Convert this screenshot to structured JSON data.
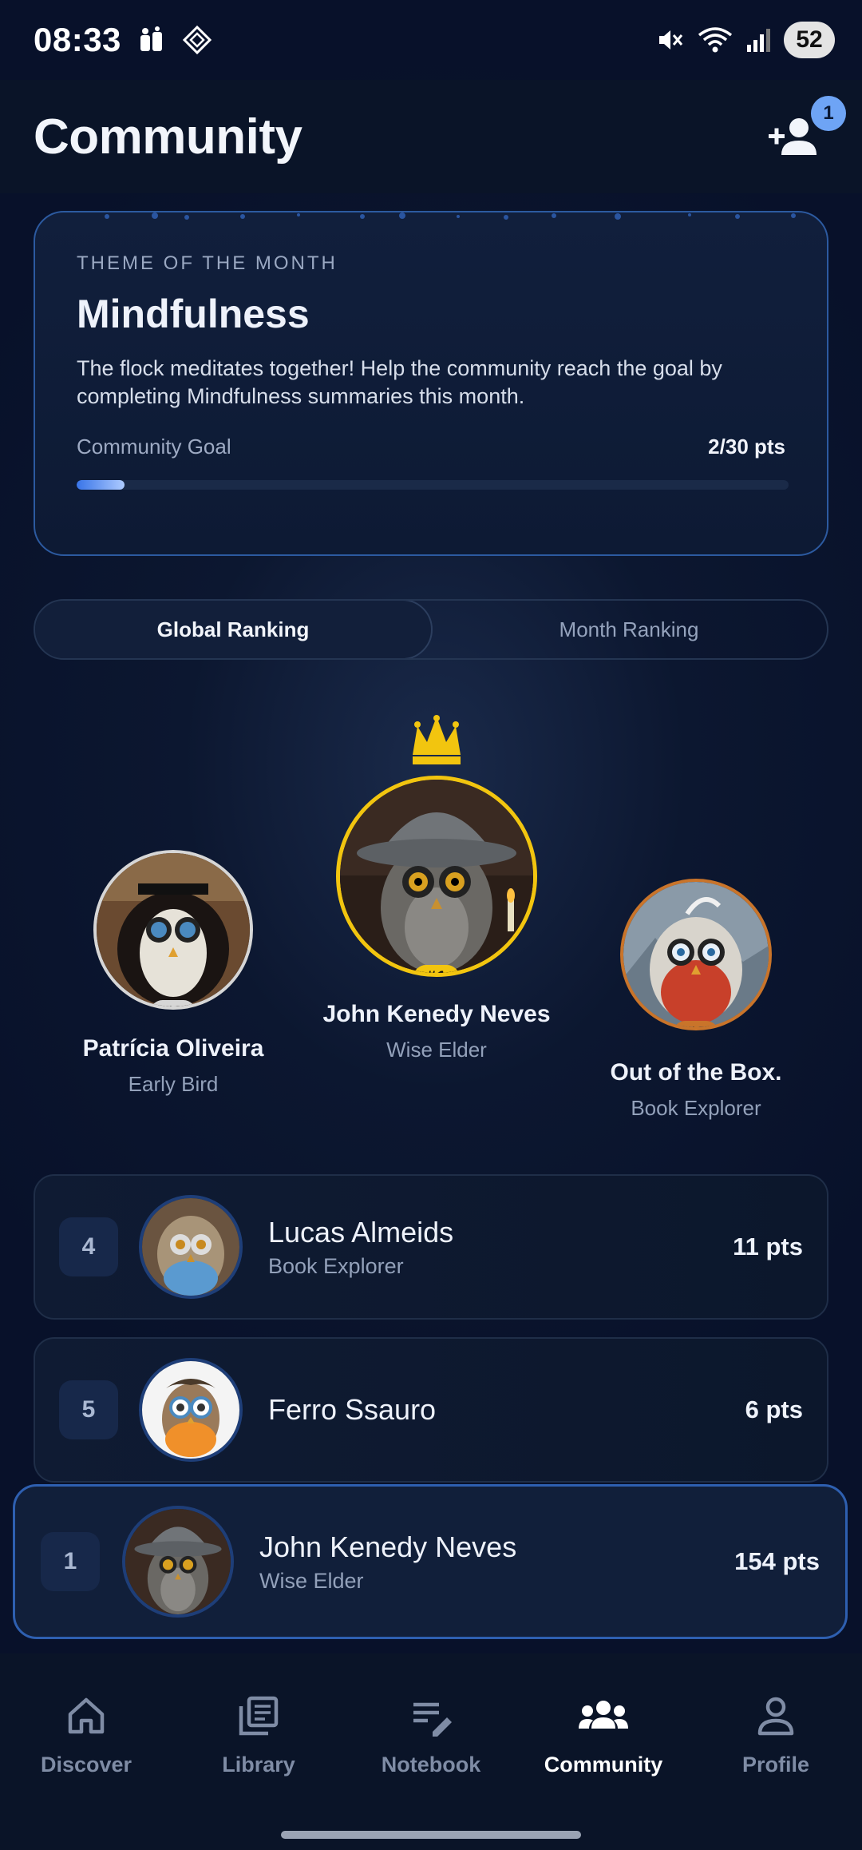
{
  "status_bar": {
    "time": "08:33",
    "battery": "52"
  },
  "header": {
    "title": "Community",
    "notification_count": "1"
  },
  "theme": {
    "label": "THEME OF THE MONTH",
    "title": "Mindfulness",
    "description": "The flock meditates together! Help the community reach the goal by completing Mindfulness summaries this month.",
    "goal_label": "Community Goal",
    "goal_value": "2/30 pts",
    "goal_progress": 0.067
  },
  "ranking_tabs": [
    {
      "label": "Global Ranking",
      "active": true
    },
    {
      "label": "Month Ranking",
      "active": false
    }
  ],
  "podium": {
    "first": {
      "rank": "#1",
      "name": "John Kenedy Neves",
      "title": "Wise Elder"
    },
    "second": {
      "rank": "#2",
      "name": "Patrícia Oliveira",
      "title": "Early Bird"
    },
    "third": {
      "rank": "#3",
      "name": "Out of the Box.",
      "title": "Book Explorer"
    }
  },
  "ranking_list": [
    {
      "rank": "4",
      "name": "Lucas Almeids",
      "title": "Book Explorer",
      "points": "11 pts"
    },
    {
      "rank": "5",
      "name": "Ferro Ssauro",
      "title": "",
      "points": "6 pts"
    }
  ],
  "current_user": {
    "rank": "1",
    "name": "John Kenedy Neves",
    "title": "Wise Elder",
    "points": "154 pts"
  },
  "bottom_nav": [
    {
      "label": "Discover",
      "icon": "home-icon",
      "active": false
    },
    {
      "label": "Library",
      "icon": "library-icon",
      "active": false
    },
    {
      "label": "Notebook",
      "icon": "notebook-icon",
      "active": false
    },
    {
      "label": "Community",
      "icon": "community-icon",
      "active": true
    },
    {
      "label": "Profile",
      "icon": "profile-icon",
      "active": false
    }
  ],
  "colors": {
    "accent": "#3874e8",
    "gold": "#f2c50f",
    "silver": "#d6d6d6",
    "bronze": "#c9742a"
  }
}
